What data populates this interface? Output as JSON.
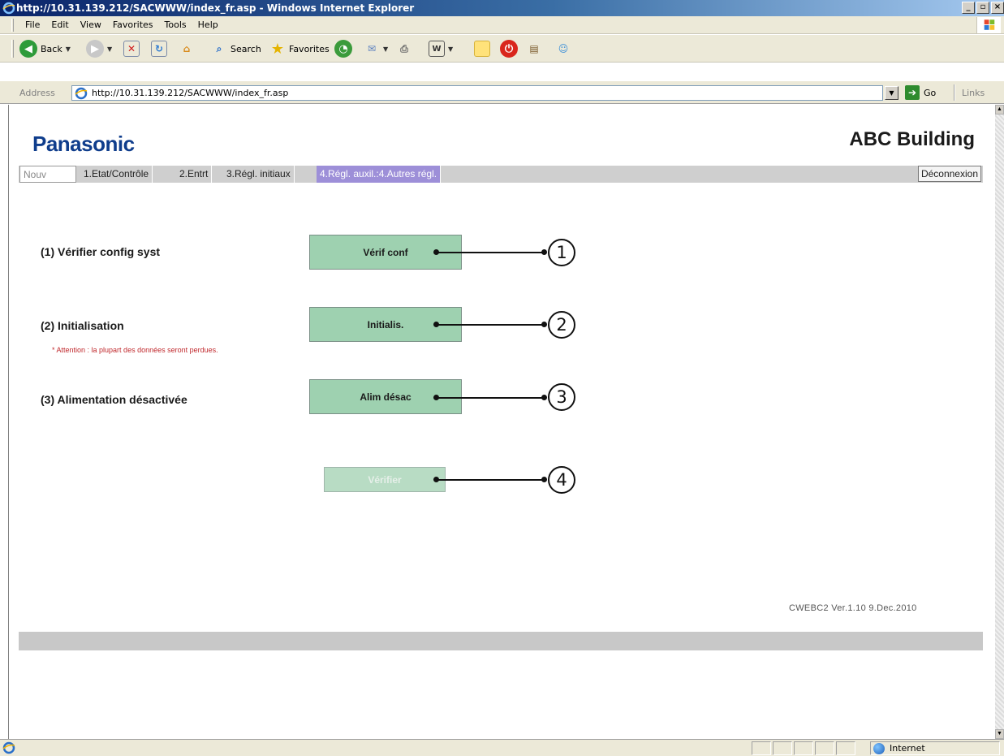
{
  "window": {
    "title": "http://10.31.139.212/SACWWW/index_fr.asp - Windows Internet Explorer",
    "controls": [
      "_",
      "×"
    ]
  },
  "menu": [
    "File",
    "Edit",
    "View",
    "Favorites",
    "Tools",
    "Help"
  ],
  "toolbar": {
    "back_label": "Back",
    "search_label": "Search",
    "favorites_label": "Favorites"
  },
  "address": {
    "label": "Address",
    "url": "http://10.31.139.212/SACWWW/index_fr.asp",
    "go_label": "Go",
    "links_label": "Links"
  },
  "page": {
    "brand": "Panasonic",
    "site_title": "ABC Building",
    "nav": {
      "new": "Nouv",
      "tab1": "1.Etat/Contrôle",
      "tab2": "2.Entrt",
      "tab3": "3.Régl. initiaux",
      "tab4": "4.Régl. auxil.:4.Autres régl.",
      "logout": "Déconnexion"
    },
    "rows": [
      {
        "label": "(1) Vérifier config syst",
        "button": "Vérif conf",
        "callout": "1"
      },
      {
        "label": "(2) Initialisation",
        "button": "Initialis.",
        "callout": "2",
        "warning": "* Attention : la plupart des données seront perdues."
      },
      {
        "label": "(3) Alimentation désactivée",
        "button": "Alim désac",
        "callout": "3"
      }
    ],
    "verify": {
      "button": "Vérifier",
      "callout": "4"
    },
    "version": "CWEBC2  Ver.1.10  9.Dec.2010"
  },
  "status": {
    "zone": "Internet"
  },
  "colors": {
    "brand_blue": "#0f3d8c",
    "button_green": "#9ed1b0",
    "active_tab": "#9d8fd8",
    "warning_red": "#c0282c"
  }
}
